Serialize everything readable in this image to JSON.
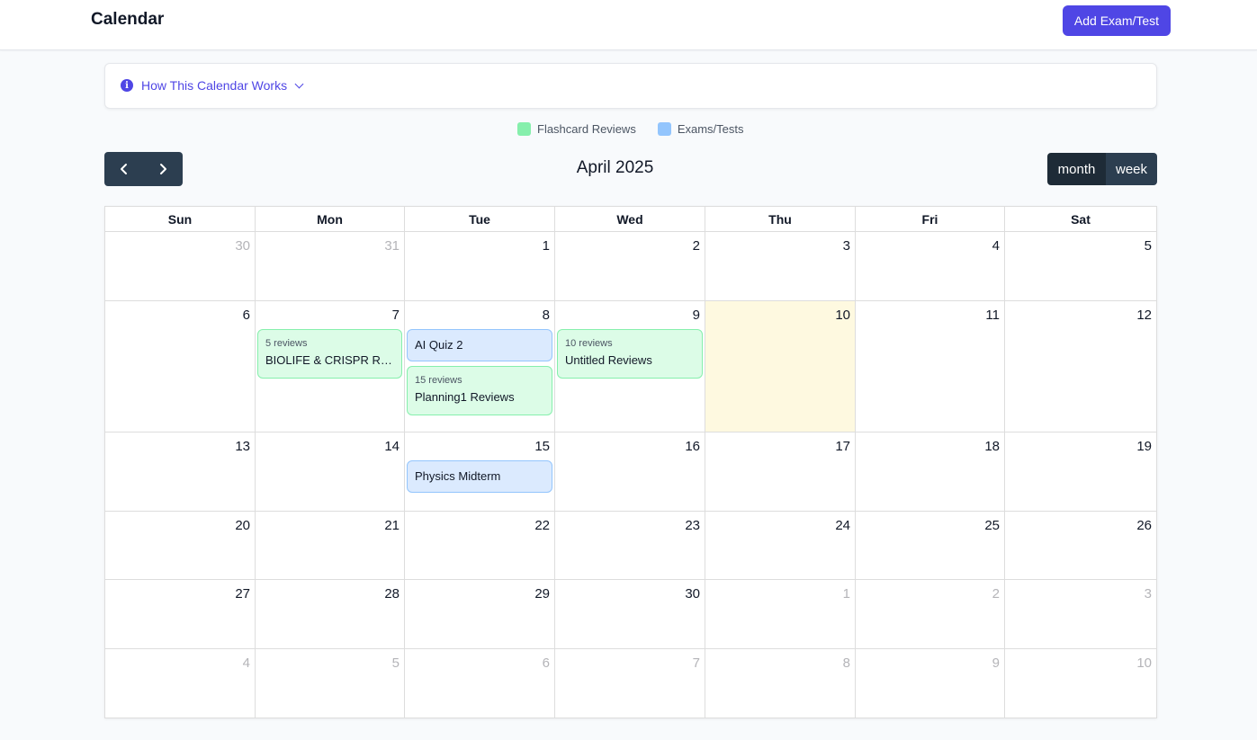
{
  "header": {
    "title": "Calendar",
    "add_button": "Add Exam/Test"
  },
  "info": {
    "toggle_label": "How This Calendar Works",
    "icon": "info-icon"
  },
  "legend": [
    {
      "label": "Flashcard Reviews",
      "color": "#86efac"
    },
    {
      "label": "Exams/Tests",
      "color": "#93c5fd"
    }
  ],
  "toolbar": {
    "title": "April 2025",
    "prev_icon": "chevron-left-icon",
    "next_icon": "chevron-right-icon",
    "views": [
      "month",
      "week"
    ],
    "active_view": "month"
  },
  "calendar": {
    "weekdays": [
      "Sun",
      "Mon",
      "Tue",
      "Wed",
      "Thu",
      "Fri",
      "Sat"
    ],
    "today": "10",
    "weeks": [
      {
        "days": [
          {
            "num": "30",
            "other": true
          },
          {
            "num": "31",
            "other": true
          },
          {
            "num": "1"
          },
          {
            "num": "2"
          },
          {
            "num": "3"
          },
          {
            "num": "4"
          },
          {
            "num": "5"
          }
        ]
      },
      {
        "days": [
          {
            "num": "6"
          },
          {
            "num": "7",
            "events": [
              {
                "kind": "review",
                "count": "5 reviews",
                "title": "BIOLIFE & CRISPR Reviews"
              }
            ]
          },
          {
            "num": "8",
            "events": [
              {
                "kind": "exam",
                "title": "AI Quiz 2"
              },
              {
                "kind": "review",
                "count": "15 reviews",
                "title": "Planning1 Reviews"
              }
            ]
          },
          {
            "num": "9",
            "events": [
              {
                "kind": "review",
                "count": "10 reviews",
                "title": "Untitled Reviews"
              }
            ]
          },
          {
            "num": "10",
            "today": true
          },
          {
            "num": "11"
          },
          {
            "num": "12"
          }
        ]
      },
      {
        "days": [
          {
            "num": "13"
          },
          {
            "num": "14"
          },
          {
            "num": "15",
            "events": [
              {
                "kind": "exam",
                "title": "Physics Midterm"
              }
            ]
          },
          {
            "num": "16"
          },
          {
            "num": "17"
          },
          {
            "num": "18"
          },
          {
            "num": "19"
          }
        ]
      },
      {
        "days": [
          {
            "num": "20"
          },
          {
            "num": "21"
          },
          {
            "num": "22"
          },
          {
            "num": "23"
          },
          {
            "num": "24"
          },
          {
            "num": "25"
          },
          {
            "num": "26"
          }
        ]
      },
      {
        "days": [
          {
            "num": "27"
          },
          {
            "num": "28"
          },
          {
            "num": "29"
          },
          {
            "num": "30"
          },
          {
            "num": "1",
            "other": true
          },
          {
            "num": "2",
            "other": true
          },
          {
            "num": "3",
            "other": true
          }
        ]
      },
      {
        "days": [
          {
            "num": "4",
            "other": true
          },
          {
            "num": "5",
            "other": true
          },
          {
            "num": "6",
            "other": true
          },
          {
            "num": "7",
            "other": true
          },
          {
            "num": "8",
            "other": true
          },
          {
            "num": "9",
            "other": true
          },
          {
            "num": "10",
            "other": true
          }
        ]
      }
    ]
  }
}
